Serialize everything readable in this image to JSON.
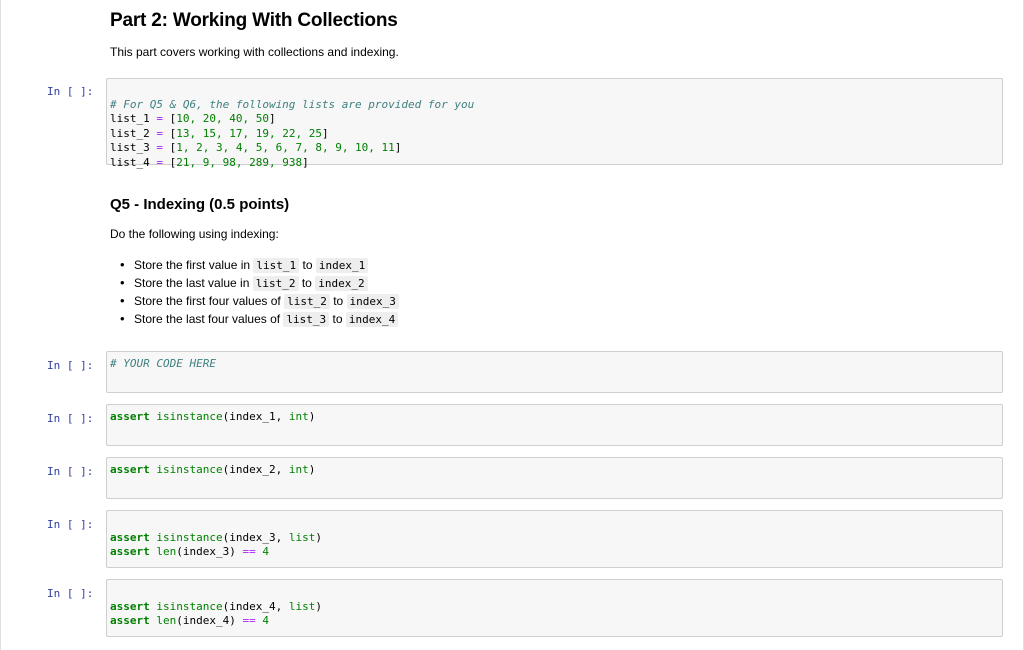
{
  "part_title": "Part 2: Working With Collections",
  "part_intro": "This part covers working with collections and indexing.",
  "prompt_label": "In [ ]:",
  "cells": {
    "lists": {
      "comment": "# For Q5 & Q6, the following lists are provided for you",
      "lines": [
        {
          "name": "list_1",
          "values": "10, 20, 40, 50"
        },
        {
          "name": "list_2",
          "values": "13, 15, 17, 19, 22, 25"
        },
        {
          "name": "list_3",
          "values": "1, 2, 3, 4, 5, 6, 7, 8, 9, 10, 11"
        },
        {
          "name": "list_4",
          "values": "21, 9, 98, 289, 938"
        }
      ]
    },
    "your_code": {
      "comment": "# YOUR CODE HERE"
    },
    "assert_1": {
      "kw": "assert",
      "fn": "isinstance",
      "args": "index_1",
      "type": "int"
    },
    "assert_2": {
      "kw": "assert",
      "fn": "isinstance",
      "args": "index_2",
      "type": "int"
    },
    "assert_3": {
      "kw": "assert",
      "fn": "isinstance",
      "args": "index_3",
      "type": "list",
      "len_fn": "len",
      "len_arg": "index_3",
      "len_val": "4"
    },
    "assert_4": {
      "kw": "assert",
      "fn": "isinstance",
      "args": "index_4",
      "type": "list",
      "len_fn": "len",
      "len_arg": "index_4",
      "len_val": "4"
    }
  },
  "q5": {
    "title": "Q5 - Indexing (0.5 points)",
    "intro": "Do the following using indexing:",
    "items": [
      {
        "pre": "Store the first value in",
        "a": "list_1",
        "mid": "to",
        "b": "index_1"
      },
      {
        "pre": "Store the last value in",
        "a": "list_2",
        "mid": "to",
        "b": "index_2"
      },
      {
        "pre": "Store the first four values of",
        "a": "list_2",
        "mid": "to",
        "b": "index_3"
      },
      {
        "pre": "Store the last four values of",
        "a": "list_3",
        "mid": "to",
        "b": "index_4"
      }
    ]
  }
}
